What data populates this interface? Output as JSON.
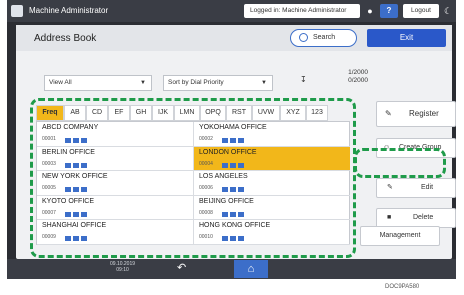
{
  "topbar": {
    "app_title": "Machine Administrator",
    "login_field": "Logged in: Machine Administrator",
    "help_label": "?",
    "logout_label": "Logout"
  },
  "header": {
    "title": "Address Book",
    "search_label": "Search",
    "exit_label": "Exit"
  },
  "filters": {
    "view": "View All",
    "sort": "Sort by Dial Priority",
    "page_count": "1/2000\n0/2000"
  },
  "tabs": [
    "Freq",
    "AB",
    "CD",
    "EF",
    "GH",
    "IJK",
    "LMN",
    "OPQ",
    "RST",
    "UVW",
    "XYZ",
    "123"
  ],
  "active_tab": 0,
  "entries": [
    {
      "name": "ABCD COMPANY",
      "number": "00001"
    },
    {
      "name": "YOKOHAMA OFFICE",
      "number": "00002"
    },
    {
      "name": "BERLIN OFFICE",
      "number": "00003"
    },
    {
      "name": "LONDON OFFICE",
      "number": "00004"
    },
    {
      "name": "NEW YORK OFFICE",
      "number": "00005"
    },
    {
      "name": "LOS ANGELES",
      "number": "00006"
    },
    {
      "name": "KYOTO OFFICE",
      "number": "00007"
    },
    {
      "name": "BEIJING OFFICE",
      "number": "00008"
    },
    {
      "name": "SHANGHAI OFFICE",
      "number": "00009"
    },
    {
      "name": "HONG KONG OFFICE",
      "number": "00010"
    }
  ],
  "selected_entry": 3,
  "actions": {
    "register": "Register",
    "create_group": "Create Group",
    "edit": "Edit",
    "delete": "Delete",
    "management": "Management"
  },
  "bottombar": {
    "time": "09.10.2019\n09:10"
  },
  "figure_code": "DOC9PA580",
  "colors": {
    "accent": "#2a58c9",
    "selected": "#f2b71a",
    "highlight": "#1f9b4a",
    "frame": "#2b2d33"
  }
}
